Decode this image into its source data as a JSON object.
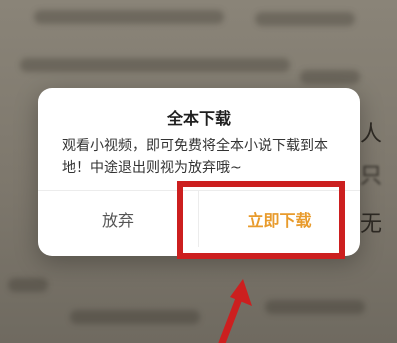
{
  "background": {
    "chars": [
      "人",
      "只",
      "无"
    ]
  },
  "dialog": {
    "title": "全本下载",
    "message": "观看小视频，即可免费将全本小说下载到本地！中途退出则视为放弃哦~",
    "cancel_label": "放弃",
    "confirm_label": "立即下载"
  },
  "colors": {
    "confirm": "#e89b2c",
    "highlight": "#cc1f1f"
  }
}
